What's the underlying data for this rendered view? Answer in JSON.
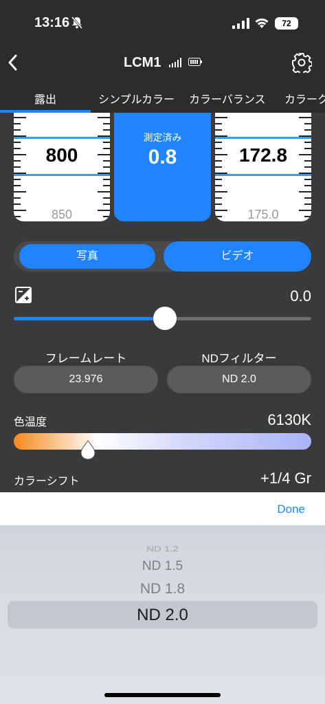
{
  "status": {
    "time": "13:16",
    "battery": "72"
  },
  "nav": {
    "title": "LCM1"
  },
  "tabs": [
    "露出",
    "シンプルカラー",
    "カラーバランス",
    "カラーク"
  ],
  "meters": {
    "left": {
      "value": "800",
      "sub": "850"
    },
    "center": {
      "label": "測定済み",
      "value": "0.8"
    },
    "right": {
      "value": "172.8",
      "sub": "175.0"
    }
  },
  "mode": {
    "photo": "写真",
    "video": "ビデオ",
    "selected": "video"
  },
  "exposure_comp": {
    "value": "0.0",
    "slider_fraction": 0.5
  },
  "frame_rate": {
    "label": "フレームレート",
    "value": "23.976"
  },
  "nd_filter": {
    "label": "NDフィルター",
    "value": "ND 2.0"
  },
  "color_temp": {
    "label": "色温度",
    "value": "6130K"
  },
  "color_shift": {
    "label": "カラーシフト",
    "value": "+1/4 Gr"
  },
  "picker": {
    "done": "Done",
    "options": [
      "ND 1.2",
      "ND 1.5",
      "ND 1.8",
      "ND 2.0"
    ],
    "selected": "ND 2.0"
  },
  "colors": {
    "accent": "#1e84ff",
    "background": "#3a3a3c",
    "bar": "#2c2c2e"
  }
}
